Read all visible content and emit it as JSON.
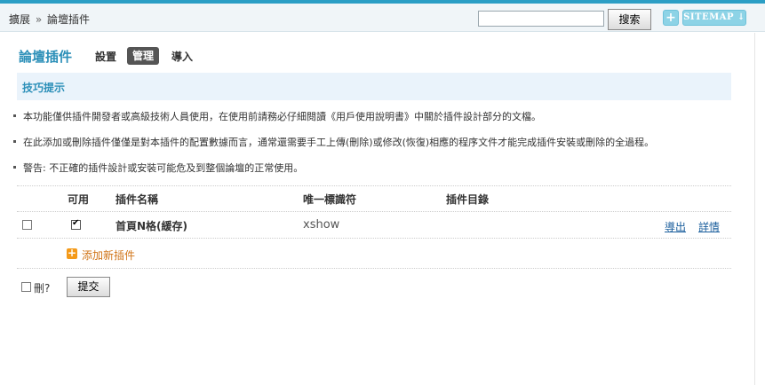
{
  "topbar": {
    "breadcrumb": [
      "擴展",
      "論壇插件"
    ],
    "breadcrumb_separator": "»",
    "search_value": "",
    "search_button": "搜索",
    "plus_label": "+",
    "sitemap_label": "SITEMAP ↓"
  },
  "header": {
    "title": "論壇插件",
    "tabs": [
      {
        "label": "設置",
        "active": false
      },
      {
        "label": "管理",
        "active": true
      },
      {
        "label": "導入",
        "active": false
      }
    ]
  },
  "tips": {
    "title": "技巧提示",
    "items": [
      "本功能僅供插件開發者或高級技術人員使用，在使用前請務必仔細閱讀《用戶使用說明書》中關於插件設計部分的文檔。",
      "在此添加或刪除插件僅僅是對本插件的配置數據而言，通常還需要手工上傳(刪除)或修改(恢復)相應的程序文件才能完成插件安裝或刪除的全過程。",
      "警告: 不正確的插件設計或安裝可能危及到整個論壇的正常使用。"
    ]
  },
  "table": {
    "headers": {
      "enable": "可用",
      "name": "插件名稱",
      "id": "唯一標識符",
      "dir": "插件目錄"
    },
    "rows": [
      {
        "selected": false,
        "enabled": true,
        "name": "首頁N格(緩存)",
        "id": "xshow",
        "dir": "",
        "actions": [
          "導出",
          "詳情"
        ]
      }
    ],
    "add_label": "添加新插件"
  },
  "footer": {
    "delete_label": "刪?",
    "submit_label": "提交"
  },
  "colors": {
    "accent": "#2b8fb8",
    "tips_bg": "#eaf3fb",
    "link": "#1a5e9c",
    "add_link": "#d07418"
  }
}
